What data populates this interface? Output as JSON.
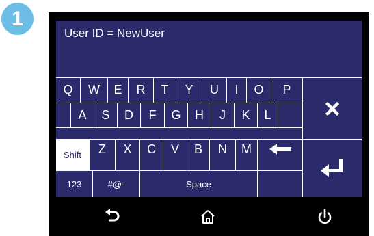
{
  "step_badge": "1",
  "display": {
    "user_id_text": "User ID = NewUser"
  },
  "keyboard": {
    "row1": [
      "Q",
      "W",
      "E",
      "R",
      "T",
      "Y",
      "U",
      "I",
      "O",
      "P"
    ],
    "row2": [
      "A",
      "S",
      "D",
      "F",
      "G",
      "H",
      "J",
      "K",
      "L"
    ],
    "row3": [
      "Z",
      "X",
      "C",
      "V",
      "B",
      "N",
      "M"
    ],
    "shift_label": "Shift",
    "numbers_label": "123",
    "symbols_label": "#@-",
    "space_label": "Space"
  },
  "icons": {
    "cancel": "close-icon",
    "backspace": "backspace-arrow-icon",
    "enter": "enter-icon",
    "back": "back-arrow-icon",
    "home": "home-icon",
    "power": "power-icon"
  },
  "colors": {
    "screen_bg": "#2b2a6a",
    "badge": "#6bbde6"
  }
}
